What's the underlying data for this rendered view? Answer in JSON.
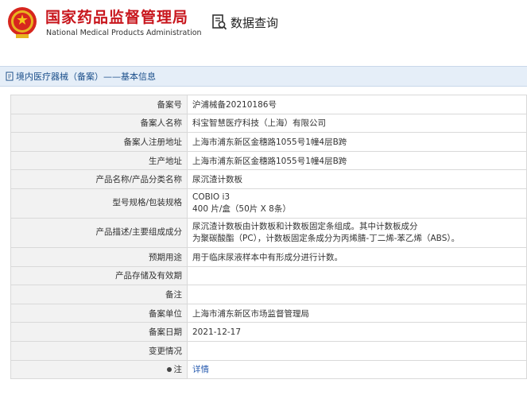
{
  "header": {
    "org_cn": "国家药品监督管理局",
    "org_en": "National Medical Products Administration",
    "query_label": "数据查询",
    "brand_color": "#c8161d"
  },
  "section": {
    "title": "境内医疗器械（备案）——基本信息"
  },
  "rows": [
    {
      "label": "备案号",
      "value": "沪浦械备20210186号"
    },
    {
      "label": "备案人名称",
      "value": "科宝智慧医疗科技（上海）有限公司"
    },
    {
      "label": "备案人注册地址",
      "value": "上海市浦东新区金穗路1055号1幢4层B跨"
    },
    {
      "label": "生产地址",
      "value": "上海市浦东新区金穗路1055号1幢4层B跨"
    },
    {
      "label": "产品名称/产品分类名称",
      "value": "尿沉渣计数板"
    },
    {
      "label": "型号规格/包装规格",
      "value_line1": "COBIO i3",
      "value_line2": "400 片/盒（50片 X 8条）"
    },
    {
      "label": "产品描述/主要组成成分",
      "value_line1": "尿沉渣计数板由计数板和计数板固定条组成。其中计数板成分",
      "value_line2": "为聚碳酸酯（PC），计数板固定条成分为丙烯腈-丁二烯-苯乙烯（ABS）。"
    },
    {
      "label": "预期用途",
      "value": "用于临床尿液样本中有形成分进行计数。"
    },
    {
      "label": "产品存储及有效期",
      "value": ""
    },
    {
      "label": "备注",
      "value": ""
    },
    {
      "label": "备案单位",
      "value": "上海市浦东新区市场监督管理局"
    },
    {
      "label": "备案日期",
      "value": "2021-12-17"
    },
    {
      "label": "变更情况",
      "value": ""
    },
    {
      "label": "注",
      "value": "详情"
    }
  ]
}
